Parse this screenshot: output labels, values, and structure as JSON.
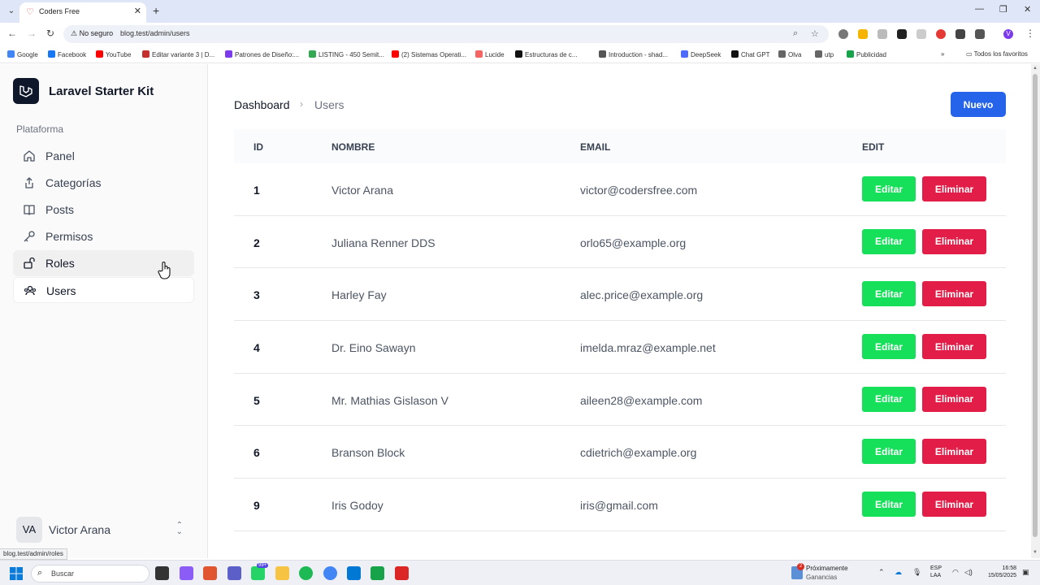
{
  "browser": {
    "tab_title": "Coders Free",
    "security_label": "No seguro",
    "url": "blog.test/admin/users",
    "status_url": "blog.test/admin/roles",
    "bookmarks": [
      {
        "label": "Google",
        "color": "#4285f4"
      },
      {
        "label": "Facebook",
        "color": "#1877f2"
      },
      {
        "label": "YouTube",
        "color": "#ff0000"
      },
      {
        "label": "Editar variante 3 | D...",
        "color": "#c4302b"
      },
      {
        "label": "Patrones de Diseño:...",
        "color": "#7c3aed"
      },
      {
        "label": "LISTING - 450 Semit...",
        "color": "#34a853"
      },
      {
        "label": "(2) Sistemas Operati...",
        "color": "#ff0000"
      },
      {
        "label": "Lucide",
        "color": "#f56565"
      },
      {
        "label": "Estructuras de c...",
        "color": "#111111"
      },
      {
        "label": "Introduction - shad...",
        "color": "#555555"
      },
      {
        "label": "DeepSeek",
        "color": "#4d6bfe"
      },
      {
        "label": "Chat GPT",
        "color": "#111111"
      },
      {
        "label": "Olva",
        "color": "#666666"
      },
      {
        "label": "utp",
        "color": "#666666"
      },
      {
        "label": "Publicidad",
        "color": "#16a34a"
      }
    ],
    "all_bookmarks": "Todos los favoritos",
    "profile_initial": "V"
  },
  "sidebar": {
    "app_title": "Laravel Starter Kit",
    "group_label": "Plataforma",
    "items": [
      {
        "label": "Panel",
        "icon": "home-icon"
      },
      {
        "label": "Categorías",
        "icon": "share-icon"
      },
      {
        "label": "Posts",
        "icon": "book-icon"
      },
      {
        "label": "Permisos",
        "icon": "key-icon"
      },
      {
        "label": "Roles",
        "icon": "lock-open-icon"
      },
      {
        "label": "Users",
        "icon": "users-icon"
      }
    ],
    "user": {
      "initials": "VA",
      "name": "Victor Arana"
    }
  },
  "breadcrumb": {
    "home": "Dashboard",
    "current": "Users"
  },
  "actions": {
    "new_label": "Nuevo"
  },
  "table": {
    "headers": {
      "id": "ID",
      "name": "NOMBRE",
      "email": "EMAIL",
      "edit": "EDIT"
    },
    "rows": [
      {
        "id": "1",
        "name": "Victor Arana",
        "email": "victor@codersfree.com"
      },
      {
        "id": "2",
        "name": "Juliana Renner DDS",
        "email": "orlo65@example.org"
      },
      {
        "id": "3",
        "name": "Harley Fay",
        "email": "alec.price@example.org"
      },
      {
        "id": "4",
        "name": "Dr. Eino Sawayn",
        "email": "imelda.mraz@example.net"
      },
      {
        "id": "5",
        "name": "Mr. Mathias Gislason V",
        "email": "aileen28@example.com"
      },
      {
        "id": "6",
        "name": "Branson Block",
        "email": "cdietrich@example.org"
      },
      {
        "id": "9",
        "name": "Iris Godoy",
        "email": "iris@gmail.com"
      }
    ],
    "edit_label": "Editar",
    "delete_label": "Eliminar"
  },
  "taskbar": {
    "search_label": "Buscar",
    "news_title": "Próximamente",
    "news_subtitle": "Ganancias",
    "news_badge": "2",
    "teams_badge": "99+",
    "lang_line1": "ESP",
    "lang_line2": "LAA",
    "time": "16:58",
    "date": "15/05/2025"
  },
  "colors": {
    "primary": "#2563eb",
    "edit": "#16e05a",
    "delete": "#e11d48"
  }
}
